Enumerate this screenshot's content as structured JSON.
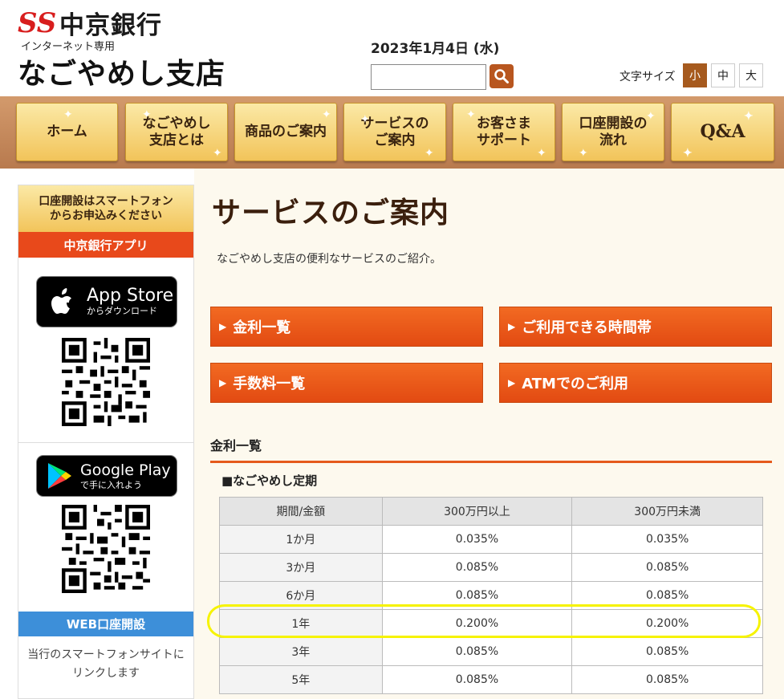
{
  "header": {
    "logo_mark": "SS",
    "bank_name": "中京銀行",
    "subtitle": "インターネット専用",
    "branch_name": "なごやめし支店",
    "date": "2023年1月4日 (水)",
    "search": {
      "value": "",
      "placeholder": ""
    },
    "font_size": {
      "label": "文字サイズ",
      "options": [
        "小",
        "中",
        "大"
      ],
      "selected": "小"
    }
  },
  "nav": {
    "items": [
      {
        "line1": "ホーム",
        "line2": ""
      },
      {
        "line1": "なごやめし",
        "line2": "支店とは"
      },
      {
        "line1": "商品のご案内",
        "line2": ""
      },
      {
        "line1": "サービスの",
        "line2": "ご案内"
      },
      {
        "line1": "お客さま",
        "line2": "サポート"
      },
      {
        "line1": "口座開設の",
        "line2": "流れ"
      },
      {
        "line1": "Q&A",
        "line2": ""
      }
    ]
  },
  "sidebar": {
    "head_line1": "口座開設はスマートフォン",
    "head_line2": "からお申込みください",
    "app_label": "中京銀行アプリ",
    "appstore": {
      "title": "App Store",
      "sub": "からダウンロード"
    },
    "googleplay": {
      "title": "Google Play",
      "sub": "で手に入れよう"
    },
    "web_label": "WEB口座開設",
    "note_line1": "当行のスマートフォンサイトに",
    "note_line2": "リンクします"
  },
  "main": {
    "title": "サービスのご案内",
    "lead": "なごやめし支店の便利なサービスのご紹介。",
    "links": [
      "金利一覧",
      "ご利用できる時間帯",
      "手数料一覧",
      "ATMでのご利用"
    ],
    "section_title": "金利一覧",
    "subsection_title": "■なごやめし定期",
    "table": {
      "headers": [
        "期間/金額",
        "300万円以上",
        "300万円未満"
      ],
      "rows": [
        [
          "1か月",
          "0.035%",
          "0.035%"
        ],
        [
          "3か月",
          "0.085%",
          "0.085%"
        ],
        [
          "6か月",
          "0.085%",
          "0.085%"
        ],
        [
          "1年",
          "0.200%",
          "0.200%"
        ],
        [
          "3年",
          "0.085%",
          "0.085%"
        ],
        [
          "5年",
          "0.085%",
          "0.085%"
        ]
      ]
    }
  },
  "colors": {
    "accent_orange": "#e24a12",
    "brand_red": "#d81e1e",
    "nav_gold": "#f2c45a",
    "web_blue": "#3d8fd9",
    "highlight_yellow": "#f6f300"
  }
}
